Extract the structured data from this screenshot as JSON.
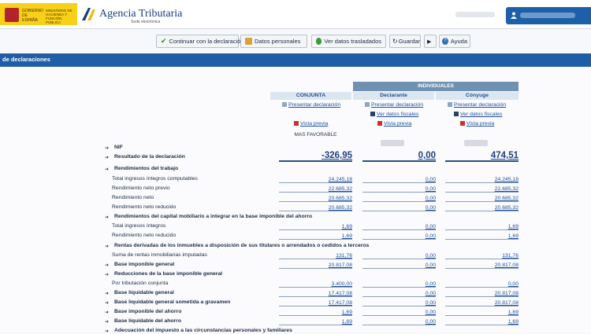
{
  "header": {
    "gov_text": "GOBIERNO DE ESPAÑA",
    "ministry_text": "MINISTERIO DE HACIENDA Y FUNCIÓN PÚBLICA",
    "app_title": "Agencia Tributaria",
    "app_subtitle": "Sede electrónica"
  },
  "toolbar": {
    "continue": "Continuar con la declaración",
    "personal": "Datos personales",
    "transferred": "Ver datos trasladados",
    "save": "Guardar",
    "help": "Ayuda"
  },
  "section_bar": "de declaraciones",
  "columns": {
    "individuales": "INDIVIDUALES",
    "conjunta": "CONJUNTA",
    "declarante": "Declarante",
    "conyuge": "Cónyuge"
  },
  "actions": {
    "presentar": "Presentar declaración",
    "ver_fiscales": "Ver datos fiscales",
    "vista_previa": "Vista previa",
    "mas_favorable": "MAS FAVORABLE"
  },
  "rows": [
    {
      "label": "NIF",
      "bold": true,
      "arrow": true
    },
    {
      "label": "Resultado de la declaración",
      "bold": true,
      "arrow": true,
      "big": true,
      "v": [
        "-326,95",
        "0,00",
        "474,51"
      ]
    },
    {
      "label": "Rendimientos del trabajo",
      "bold": true,
      "arrow": true
    },
    {
      "label": "Total ingresos íntegros computables",
      "v": [
        "24.245,18",
        "0,00",
        "24.245,18"
      ]
    },
    {
      "label": "Rendimiento neto previo",
      "v": [
        "22.685,32",
        "0,00",
        "22.685,32"
      ]
    },
    {
      "label": "Rendimiento neto",
      "v": [
        "20.685,32",
        "0,00",
        "20.685,32"
      ]
    },
    {
      "label": "Rendimiento neto reducido",
      "v": [
        "20.685,32",
        "0,00",
        "20.685,32"
      ]
    },
    {
      "label": "Rendimientos del capital mobiliario a integrar en la base imponible del ahorro",
      "bold": true,
      "arrow": true
    },
    {
      "label": "Total ingresos íntegros",
      "v": [
        "1,69",
        "0,00",
        "1,69"
      ]
    },
    {
      "label": "Rendimiento neto reducido",
      "v": [
        "1,69",
        "0,00",
        "1,69"
      ]
    },
    {
      "label": "Rentas derivadas de los inmuebles a disposición de sus titulares o arrendados o cedidos a terceros",
      "bold": true,
      "arrow": true
    },
    {
      "label": "Suma de rentas inmobiliarias imputadas",
      "v": [
        "131,76",
        "0,00",
        "131,76"
      ]
    },
    {
      "label": "Base imponible general",
      "bold": true,
      "arrow": true,
      "v": [
        "20.817,08",
        "0,00",
        "20.817,08"
      ]
    },
    {
      "label": "Reducciones de la base imponible general",
      "bold": true,
      "arrow": true
    },
    {
      "label": "Por tributación conjunta",
      "v": [
        "3.400,00",
        "0,00",
        "0,00"
      ]
    },
    {
      "label": "Base liquidable general",
      "bold": true,
      "arrow": true,
      "v": [
        "17.417,08",
        "0,00",
        "20.817,08"
      ]
    },
    {
      "label": "Base liquidable general sometida a gravamen",
      "bold": true,
      "arrow": true,
      "v": [
        "17.417,08",
        "0,00",
        "20.817,08"
      ]
    },
    {
      "label": "Base imponible del ahorro",
      "bold": true,
      "arrow": true,
      "v": [
        "1,69",
        "0,00",
        "1,69"
      ]
    },
    {
      "label": "Base liquidable del ahorro",
      "bold": true,
      "arrow": true,
      "v": [
        "1,69",
        "0,00",
        "1,69"
      ]
    },
    {
      "label": "Adecuación del impuesto a las circunstancias personales y familiares",
      "bold": true,
      "arrow": true
    }
  ]
}
